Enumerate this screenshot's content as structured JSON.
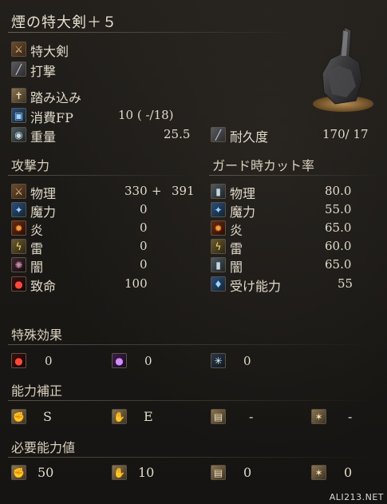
{
  "weapon": {
    "name": "煙の特大剣＋５",
    "type": "特大剣",
    "attack_type": "打撃",
    "skill": "踏み込み",
    "fp_label": "消費FP",
    "fp_value": "10 (  -/18)",
    "weight_label": "重量",
    "weight_value": "25.5",
    "durability_label": "耐久度",
    "durability_value": "170/  17"
  },
  "attack": {
    "header": "攻撃力",
    "rows": [
      {
        "label": "物理",
        "base": "330",
        "plus": "+",
        "value": "391",
        "icon": "physical-attack-icon"
      },
      {
        "label": "魔力",
        "value": "0",
        "icon": "magic-attack-icon"
      },
      {
        "label": "炎",
        "value": "0",
        "icon": "fire-attack-icon"
      },
      {
        "label": "雷",
        "value": "0",
        "icon": "lightning-attack-icon"
      },
      {
        "label": "闇",
        "value": "0",
        "icon": "dark-attack-icon"
      },
      {
        "label": "致命",
        "value": "100",
        "icon": "critical-icon"
      }
    ]
  },
  "guard": {
    "header": "ガード時カット率",
    "rows": [
      {
        "label": "物理",
        "value": "80.0",
        "icon": "physical-guard-icon"
      },
      {
        "label": "魔力",
        "value": "55.0",
        "icon": "magic-guard-icon"
      },
      {
        "label": "炎",
        "value": "65.0",
        "icon": "fire-guard-icon"
      },
      {
        "label": "雷",
        "value": "60.0",
        "icon": "lightning-guard-icon"
      },
      {
        "label": "闇",
        "value": "65.0",
        "icon": "dark-guard-icon"
      },
      {
        "label": "受け能力",
        "value": "55",
        "icon": "stability-icon"
      }
    ]
  },
  "special": {
    "header": "特殊効果",
    "items": [
      {
        "value": "0",
        "icon": "bleed-icon"
      },
      {
        "value": "0",
        "icon": "poison-icon"
      },
      {
        "value": "0",
        "icon": "frost-icon"
      }
    ]
  },
  "scaling": {
    "header": "能力補正",
    "items": [
      {
        "value": "S",
        "icon": "strength-icon"
      },
      {
        "value": "E",
        "icon": "dexterity-icon"
      },
      {
        "value": "-",
        "icon": "intelligence-icon"
      },
      {
        "value": "-",
        "icon": "faith-icon"
      }
    ]
  },
  "requirements": {
    "header": "必要能力値",
    "items": [
      {
        "value": "50",
        "icon": "strength-req-icon"
      },
      {
        "value": "10",
        "icon": "dexterity-req-icon"
      },
      {
        "value": "0",
        "icon": "intelligence-req-icon"
      },
      {
        "value": "0",
        "icon": "faith-req-icon"
      }
    ]
  },
  "watermark": "ALI213.NET"
}
